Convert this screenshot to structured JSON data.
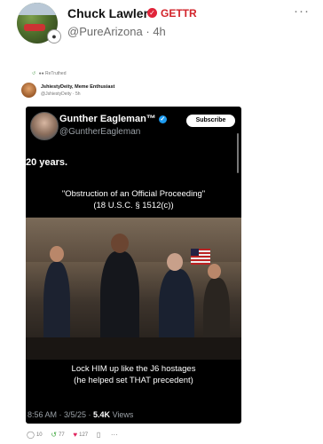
{
  "post": {
    "author_name": "Chuck Lawler",
    "platform_label": "GETTR",
    "handle": "@PureArizona",
    "time_ago": "4h",
    "more_label": "···"
  },
  "retruth": {
    "label": "ReTruthed",
    "inner_name": "JshiestyDeity, Meme Enthusiast",
    "inner_handle": "@JshiestyDeity · 5h"
  },
  "card": {
    "name": "Gunther Eagleman™",
    "handle": "@GuntherEagleman",
    "subscribe_label": "Subscribe",
    "years": "20 years.",
    "obstruction_line1": "\"Obstruction of an Official Proceeding\"",
    "obstruction_line2": "(18 U.S.C. § 1512(c))",
    "caption_line1": "Lock HIM up like the J6 hostages",
    "caption_line2": "(he helped set THAT precedent)",
    "timestamp": "8:56 AM · 3/5/25 · ",
    "views": "5.4K",
    "views_label": " Views"
  },
  "actions": {
    "replies": "10",
    "retruths": "77",
    "likes": "127"
  },
  "colors": {
    "platform_red": "#d2232a",
    "verified_blue": "#1d9bf0",
    "like_pink": "#e0245e"
  }
}
